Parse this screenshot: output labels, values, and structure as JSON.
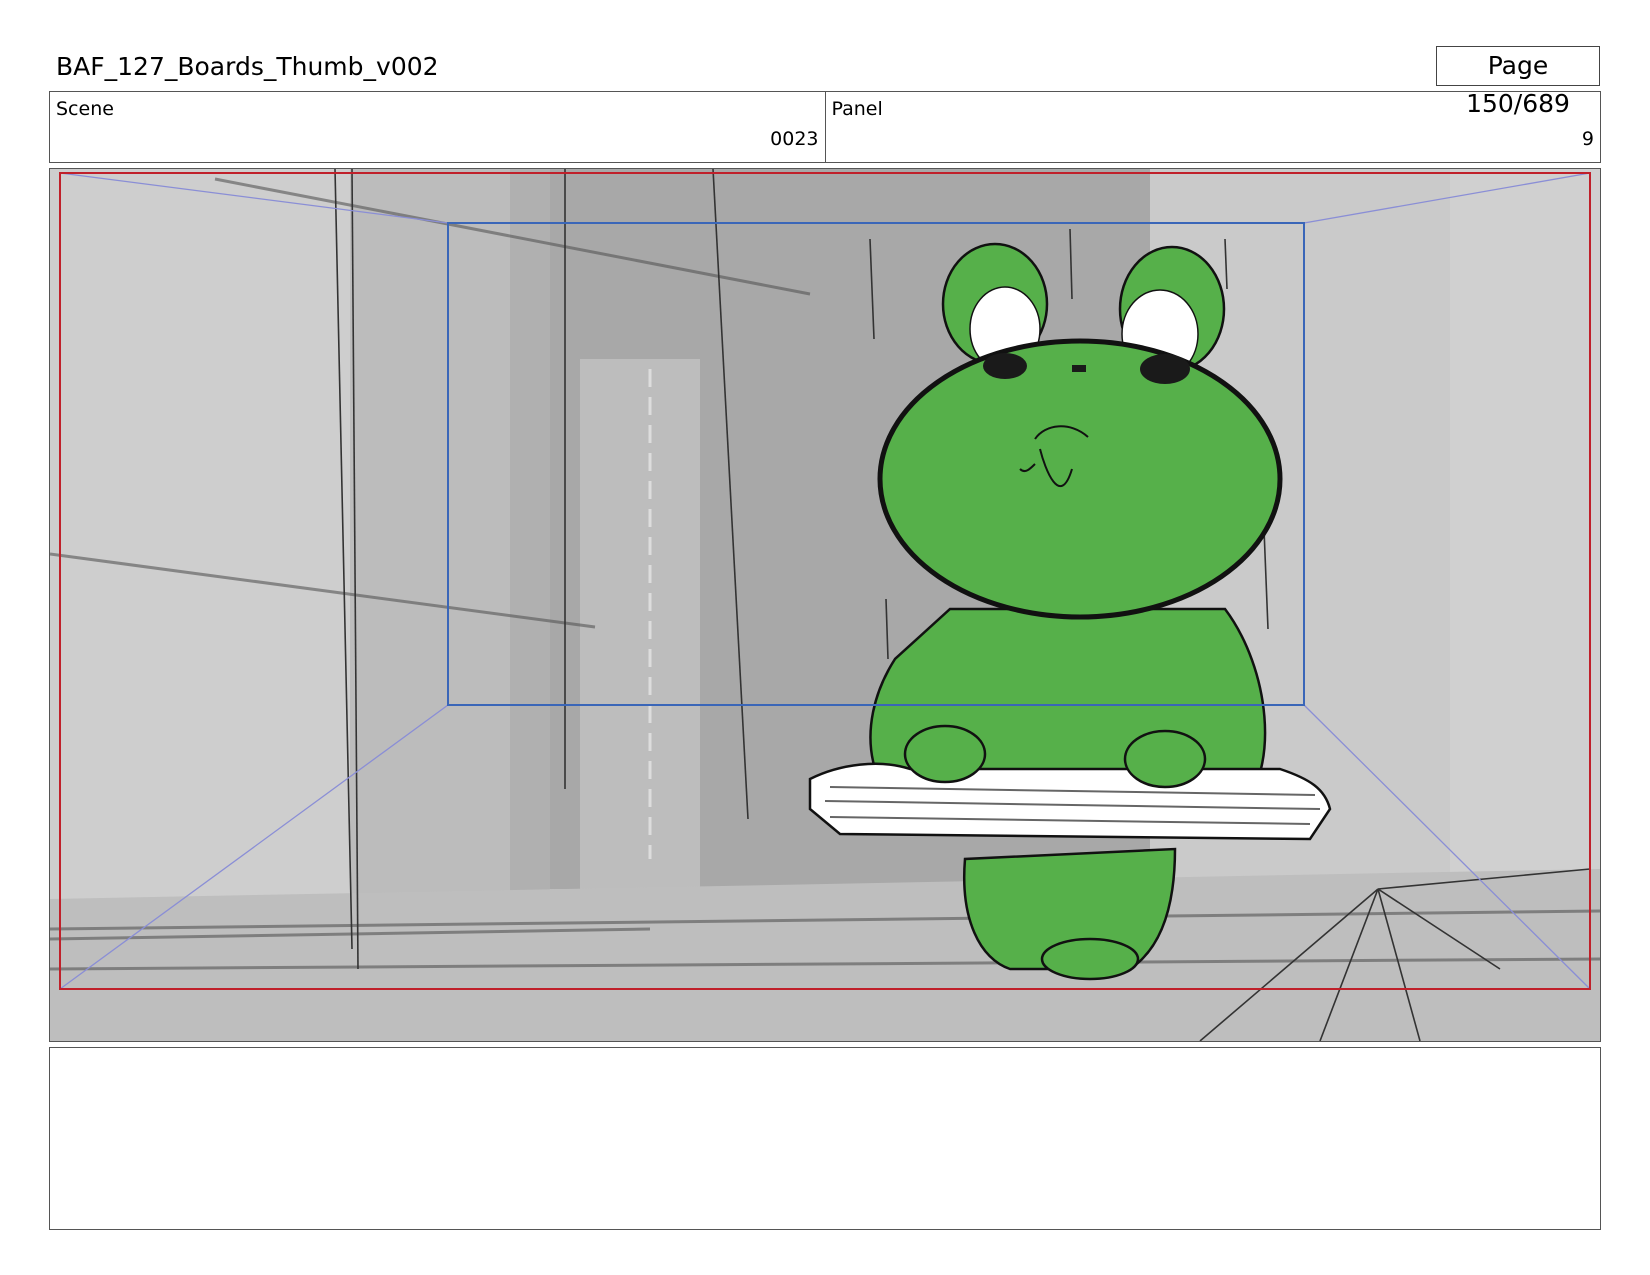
{
  "header": {
    "title": "BAF_127_Boards_Thumb_v002",
    "page": "Page 150/689"
  },
  "info": {
    "scene_label": "Scene",
    "scene_value": "0023",
    "panel_label": "Panel",
    "panel_value": "9"
  },
  "panel": {
    "subject": "frog-character-holding-tray"
  },
  "colors": {
    "frog_green": "#56b04a",
    "safe_frame": "#3a66b8",
    "outer_frame": "#c0202a",
    "background_gray": "#bcbcbc"
  },
  "notes": {
    "text": ""
  }
}
